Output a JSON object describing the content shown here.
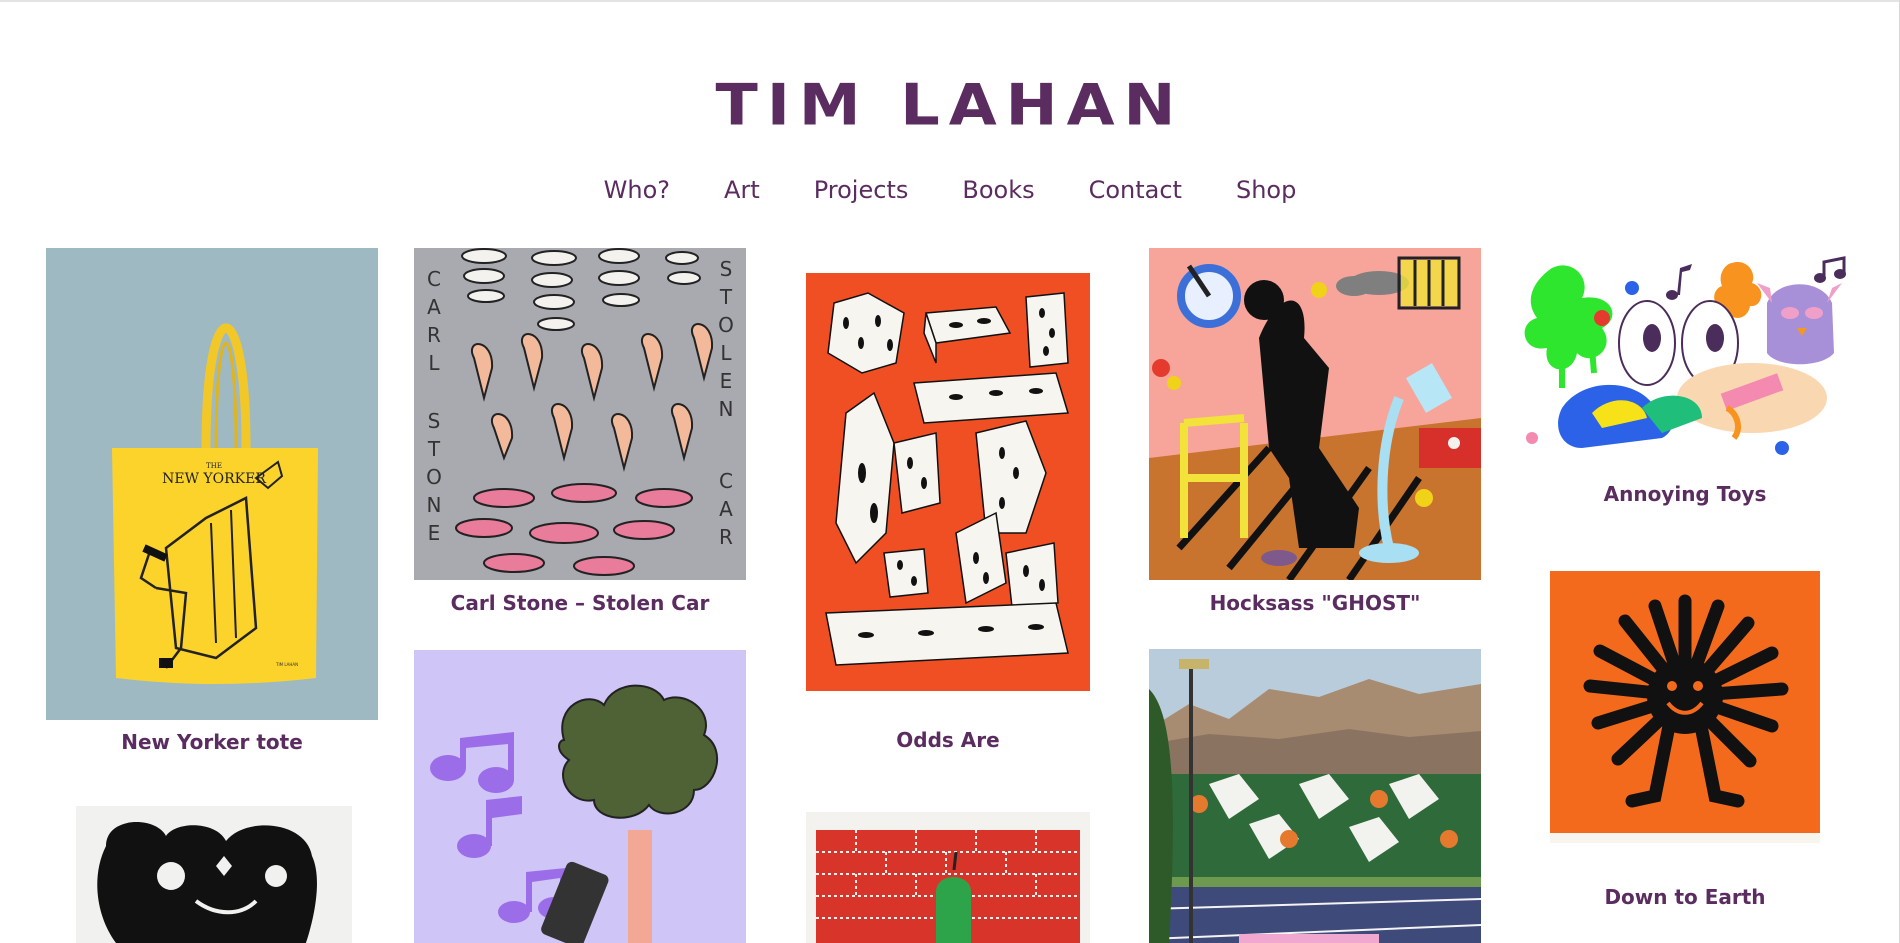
{
  "site": {
    "logo": "TIM LAHAN"
  },
  "nav": [
    "Who?",
    "Art",
    "Projects",
    "Books",
    "Contact",
    "Shop"
  ],
  "items": [
    {
      "title": "New Yorker tote",
      "tote_text": "NEW YORKER",
      "tote_sub": "THE",
      "tote_sig": "TIM LAHAN"
    },
    {
      "title": "Carl Stone – Stolen Car",
      "left_letters": [
        "C",
        "A",
        "R",
        "L",
        "S",
        "T",
        "O",
        "N",
        "E"
      ],
      "right_letters": [
        "S",
        "T",
        "O",
        "L",
        "E",
        "N",
        "C",
        "A",
        "R"
      ]
    },
    {
      "title": "Odds Are"
    },
    {
      "title": "Hocksass \"GHOST\""
    },
    {
      "title": "Annoying Toys"
    },
    {
      "title": "Down to Earth"
    }
  ],
  "colors": {
    "accent": "#5b2c5f"
  }
}
